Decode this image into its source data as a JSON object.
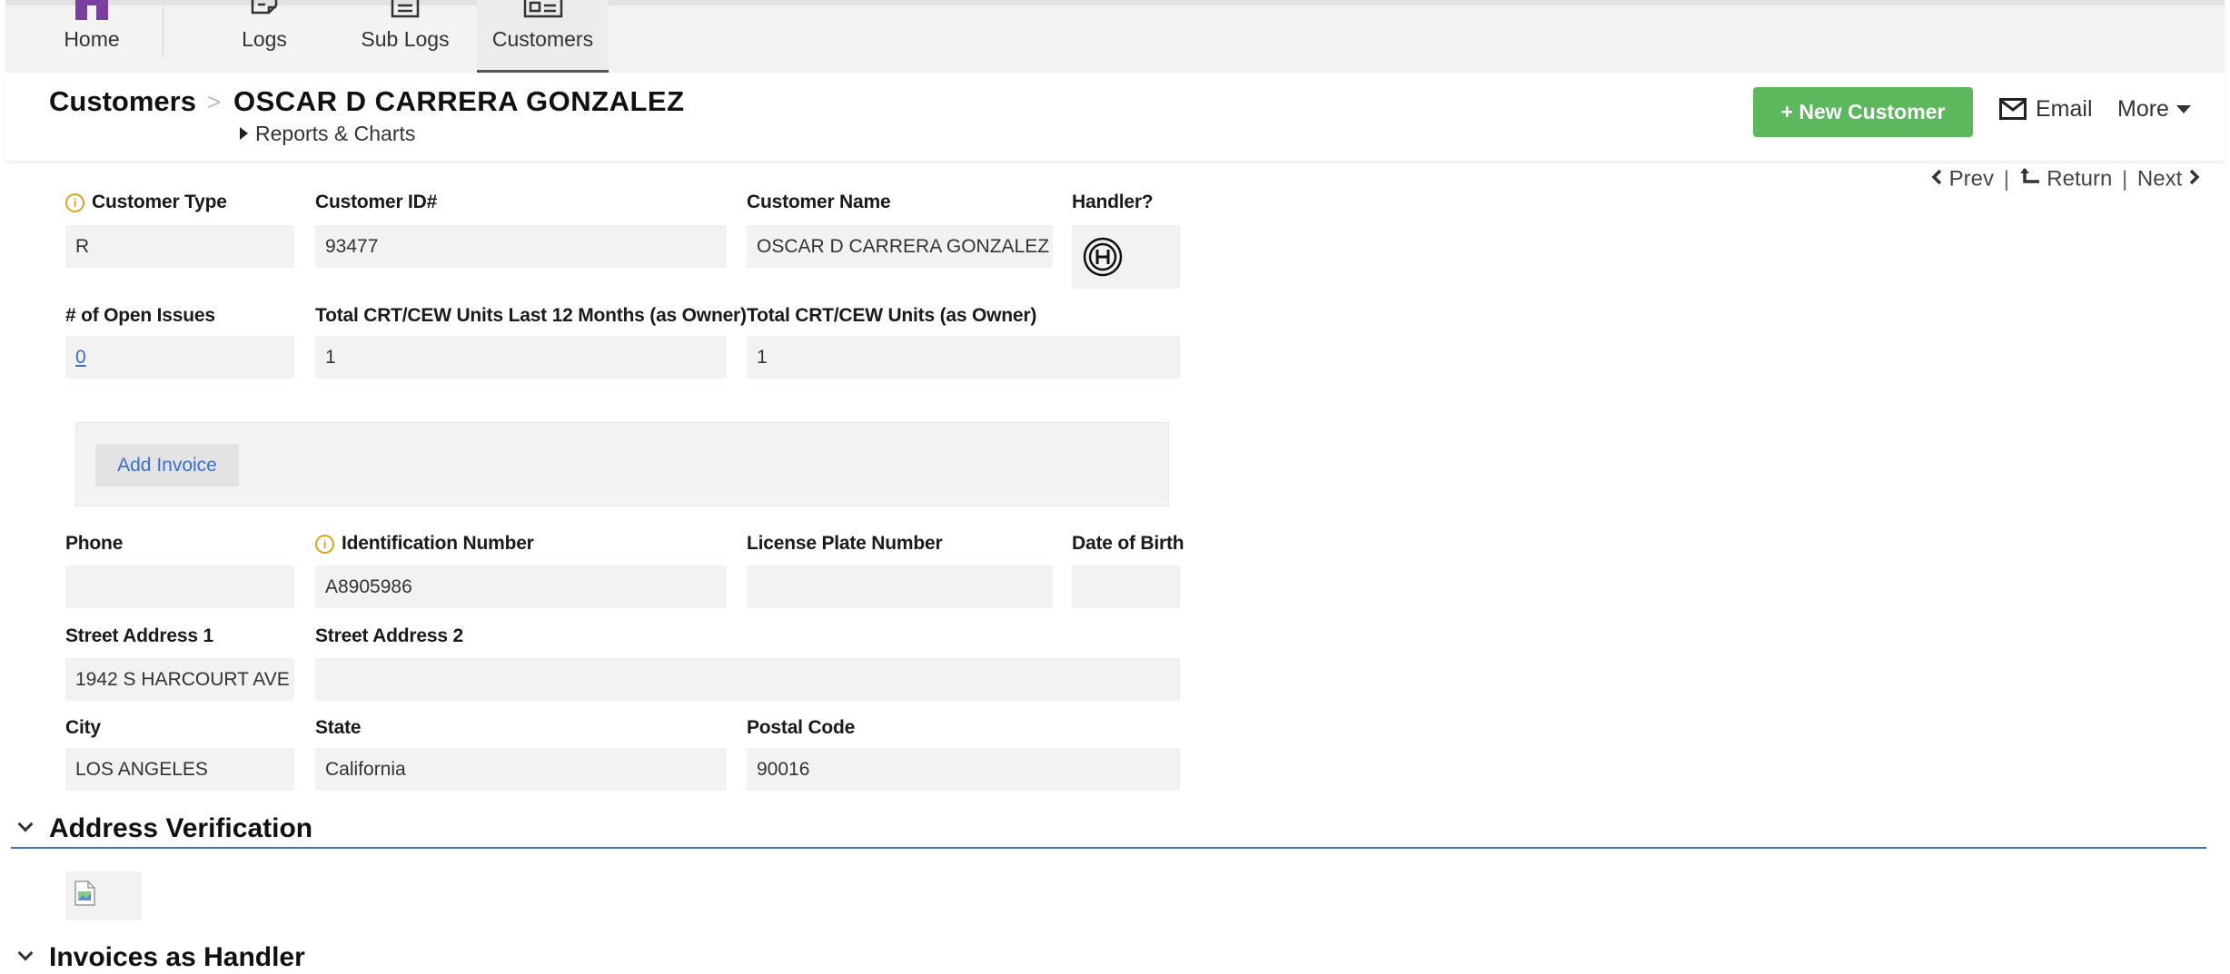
{
  "nav": {
    "items": [
      {
        "label": "Home",
        "icon": "home-icon"
      },
      {
        "label": "Logs",
        "icon": "logs-icon"
      },
      {
        "label": "Sub Logs",
        "icon": "sub-logs-icon"
      },
      {
        "label": "Customers",
        "icon": "customers-icon",
        "active": true
      }
    ]
  },
  "header": {
    "breadcrumb_root": "Customers",
    "breadcrumb_separator": ">",
    "title": "OSCAR D CARRERA GONZALEZ",
    "reports_link": "Reports & Charts",
    "new_customer_label": "+ New Customer",
    "email_label": "Email",
    "more_label": "More"
  },
  "pager": {
    "prev": "Prev",
    "return": "Return",
    "next": "Next",
    "separator": "|"
  },
  "form": {
    "customer_type": {
      "label": "Customer Type",
      "value": "R"
    },
    "customer_id": {
      "label": "Customer ID#",
      "value": "93477"
    },
    "customer_name": {
      "label": "Customer Name",
      "value": "OSCAR D CARRERA GONZALEZ"
    },
    "handler": {
      "label": "Handler?",
      "icon": "handler-h-icon"
    },
    "open_issues": {
      "label": "# of Open Issues",
      "value": "0"
    },
    "units_12m": {
      "label": "Total CRT/CEW Units Last 12 Months (as Owner)",
      "value": "1"
    },
    "units_total": {
      "label": "Total CRT/CEW Units (as Owner)",
      "value": "1"
    },
    "add_invoice_label": "Add Invoice",
    "phone": {
      "label": "Phone",
      "value": ""
    },
    "identification_number": {
      "label": "Identification Number",
      "value": "A8905986"
    },
    "license_plate": {
      "label": "License Plate Number",
      "value": ""
    },
    "date_of_birth": {
      "label": "Date of Birth",
      "value": ""
    },
    "street1": {
      "label": "Street Address 1",
      "value": "1942 S HARCOURT AVE"
    },
    "street2": {
      "label": "Street Address 2",
      "value": ""
    },
    "city": {
      "label": "City",
      "value": "LOS ANGELES"
    },
    "state": {
      "label": "State",
      "value": "California"
    },
    "postal_code": {
      "label": "Postal Code",
      "value": "90016"
    }
  },
  "sections": {
    "address_verification": "Address Verification",
    "invoices_as_handler": "Invoices as Handler"
  },
  "colors": {
    "accent_green": "#5cb85c",
    "link_blue": "#3b6fc9",
    "info_orange": "#e3a21a",
    "nav_home_purple": "#7b3fa0"
  }
}
